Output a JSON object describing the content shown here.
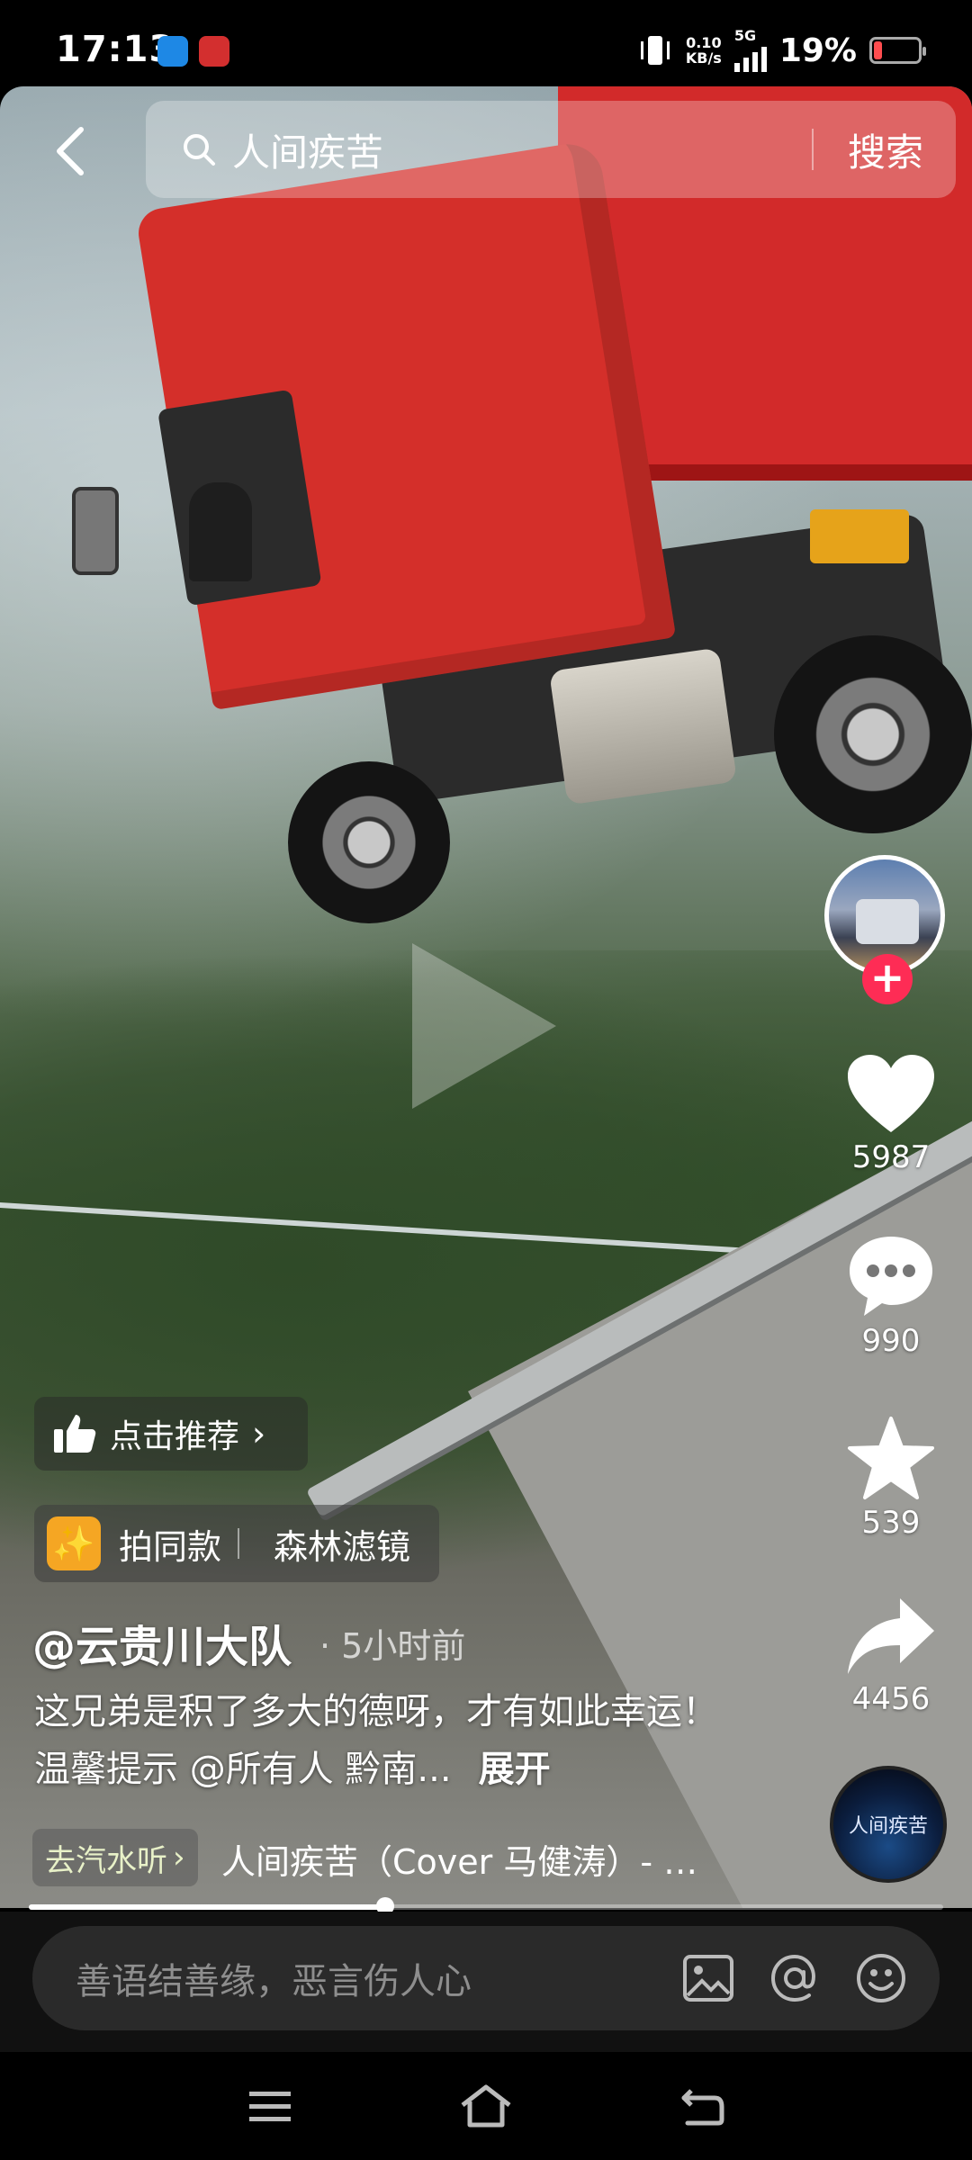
{
  "status_bar": {
    "time": "17:13",
    "net_speed_value": "0.10",
    "net_speed_unit": "KB/s",
    "network": "5G",
    "battery": "19%",
    "battery_level": 0.19
  },
  "search": {
    "query": "人间疾苦",
    "button_label": "搜索"
  },
  "actions": {
    "likes": "5987",
    "comments": "990",
    "favorites": "539",
    "shares": "4456"
  },
  "video": {
    "recommend_label": "点击推荐",
    "shoot_same_label": "拍同款",
    "filter_label": "森林滤镜",
    "author": "@云贵川大队",
    "time_ago": "· 5小时前",
    "description": "这兄弟是积了多大的德呀，才有如此幸运！ 温馨提示 @所有人 黔南...",
    "expand_label": "展开",
    "music_tag": "去汽水听",
    "music_title": "人间疾苦（Cover 马健涛）- …",
    "disc_text": "人间疾苦",
    "progress": 0.39
  },
  "comment": {
    "placeholder": "善语结善缘，恶言伤人心"
  },
  "colors": {
    "accent": "#fe2c55",
    "battery_low": "#ff4d4f"
  }
}
